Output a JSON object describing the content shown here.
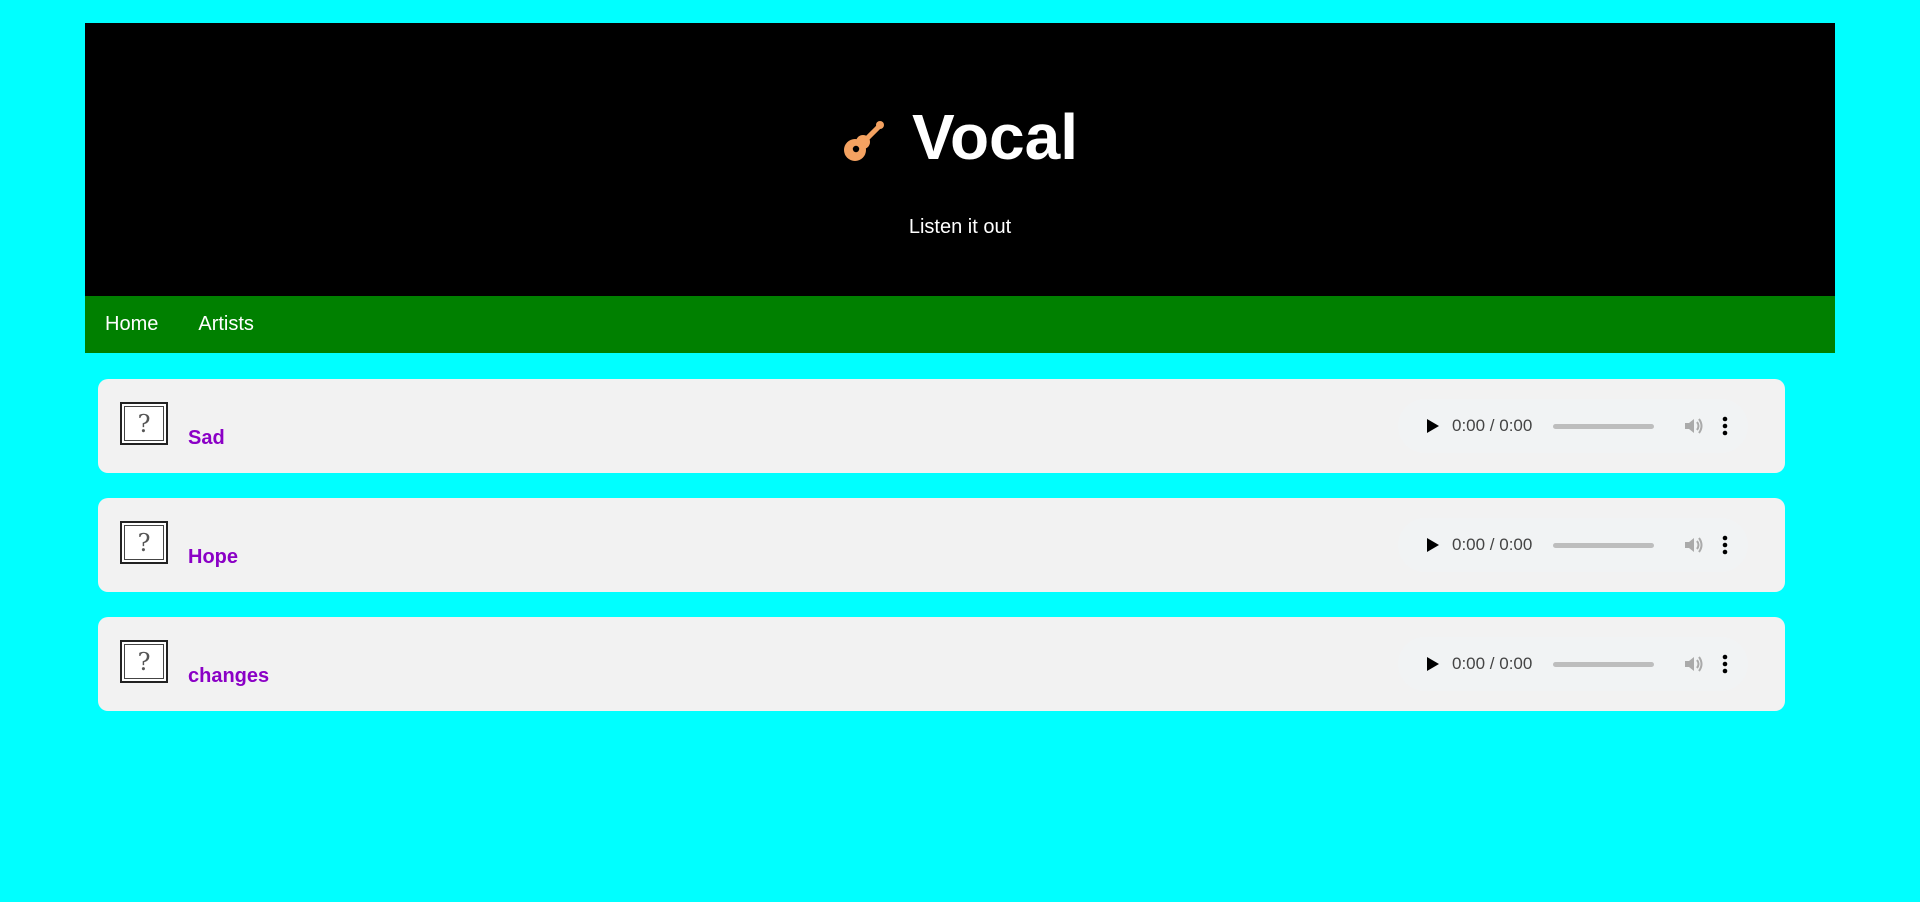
{
  "header": {
    "title": "Vocal",
    "tagline": "Listen it out",
    "logo_icon": "guitar-icon",
    "logo_color": "#f4a261"
  },
  "nav": {
    "items": [
      {
        "label": "Home"
      },
      {
        "label": "Artists"
      }
    ]
  },
  "tracks": [
    {
      "name": "Sad",
      "thumb_icon": "broken-image-icon",
      "time": "0:00 / 0:00"
    },
    {
      "name": "Hope",
      "thumb_icon": "broken-image-icon",
      "time": "0:00 / 0:00"
    },
    {
      "name": "changes",
      "thumb_icon": "broken-image-icon",
      "time": "0:00 / 0:00"
    }
  ],
  "colors": {
    "page_background": "#00ffff",
    "header_background": "#000000",
    "nav_background": "#008000",
    "track_name": "#8b00c6"
  }
}
